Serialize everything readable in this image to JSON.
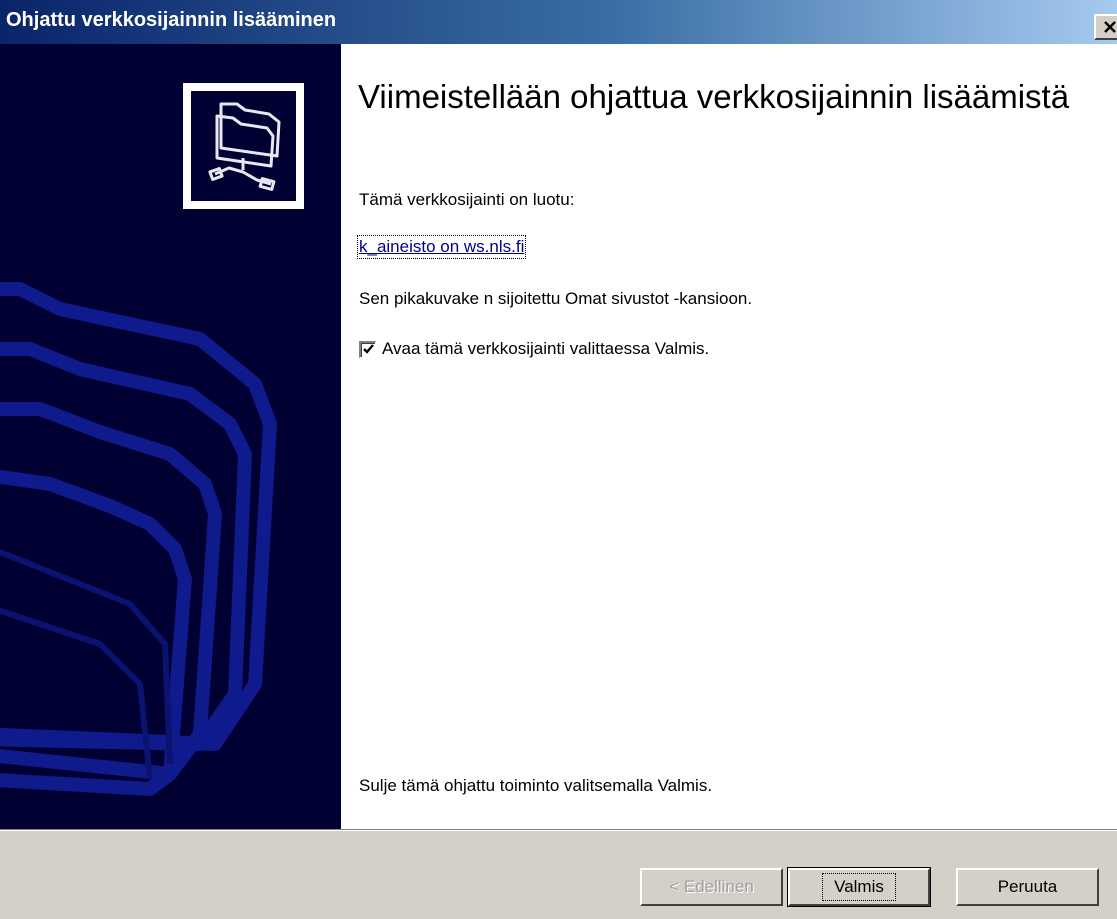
{
  "window": {
    "title": "Ohjattu verkkosijainnin lisääminen"
  },
  "colors": {
    "title_active_start": "#0a246a",
    "title_active_end": "#a6caf0",
    "sidebar_bg": "#000033",
    "sidebar_art": "#0f1a8c",
    "link": "#00008b",
    "face": "#d4d0c8"
  },
  "icons": {
    "close": "close-icon",
    "wizard": "network-folder-icon",
    "checkbox_check": "checkmark-icon"
  },
  "main": {
    "heading": "Viimeistellään ohjattua verkkosijainnin lisäämistä",
    "created_text": "Tämä verkkosijainti on luotu:",
    "location_link": "k_aineisto on ws.nls.fi",
    "shortcut_text": "Sen pikakuvake n sijoitettu Omat sivustot -kansioon.",
    "open_checkbox": {
      "label": "Avaa tämä verkkosijainti valittaessa Valmis.",
      "checked": true
    },
    "finish_text": "Sulje tämä ohjattu toiminto valitsemalla Valmis."
  },
  "buttons": {
    "back_label": "< Edellinen",
    "back_enabled": false,
    "finish_label": "Valmis",
    "cancel_label": "Peruuta"
  }
}
